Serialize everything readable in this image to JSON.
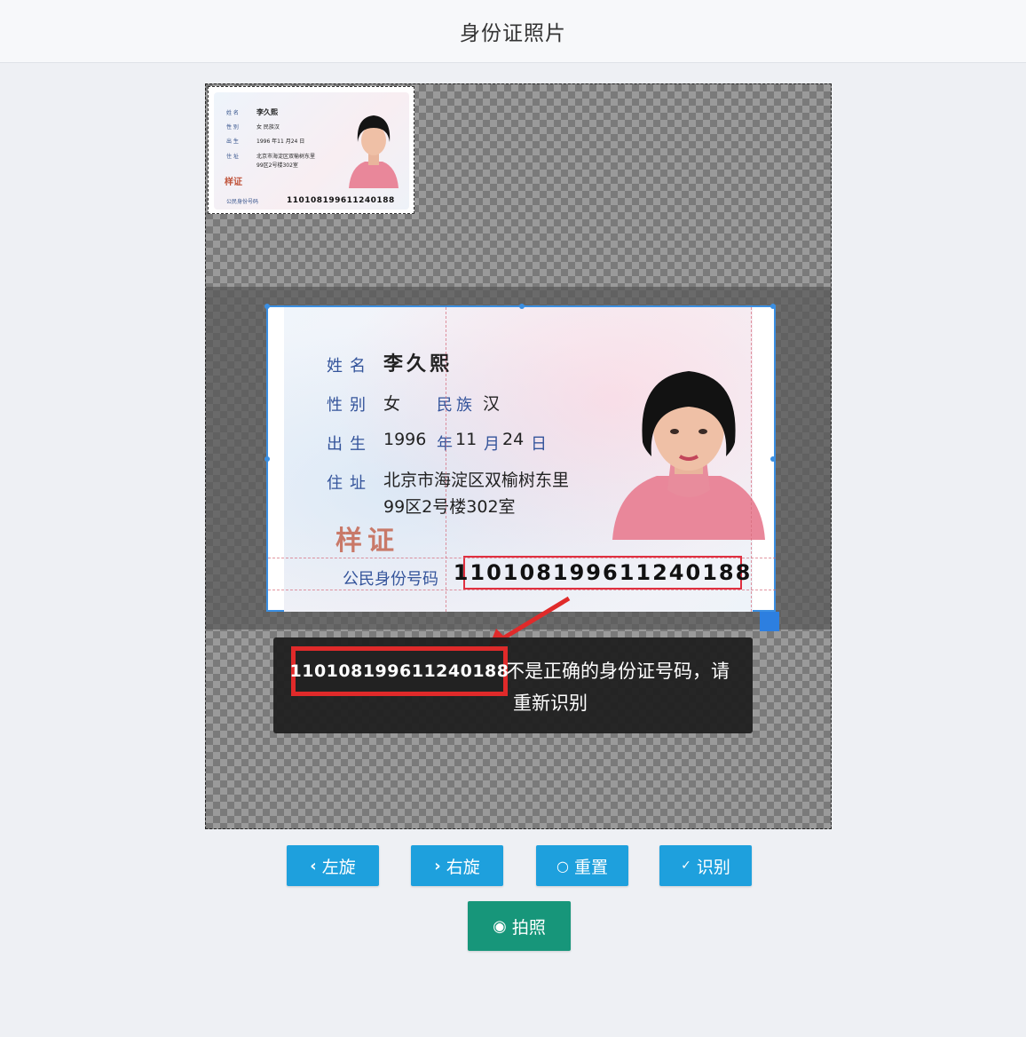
{
  "header": {
    "title": "身份证照片"
  },
  "thumbnail": {
    "labels": [
      "姓 名",
      "性 别",
      "出 生",
      "住 址",
      "公民身份号码"
    ],
    "values": [
      "李久熙",
      "女   民族汉",
      "1996 年11 月24 日",
      "北京市海淀区双榆树东里",
      "99区2号楼302室"
    ],
    "stamp": "样证",
    "id_number": "110108199611240188"
  },
  "card": {
    "name_label": "姓名",
    "name": "李久熙",
    "sex_label": "性别",
    "sex": "女",
    "ethnicity_label": "民族",
    "ethnicity": "汉",
    "birth_label": "出生",
    "birth_year": "1996",
    "birth_year_unit": "年",
    "birth_month": "11",
    "birth_month_unit": "月",
    "birth_day": "24",
    "birth_day_unit": "日",
    "address_label": "住址",
    "address_line1": "北京市海淀区双榆树东里",
    "address_line2": "99区2号楼302室",
    "stamp": "样证",
    "id_label": "公民身份号码",
    "id_number": "110108199611240188"
  },
  "toast": {
    "id_number": "110108199611240188",
    "message_line1": "不是正确的身份证号码，请",
    "message_line2": "重新识别"
  },
  "buttons": {
    "rotate_left": {
      "icon": "chevron-left-icon",
      "label": "左旋"
    },
    "rotate_right": {
      "icon": "chevron-right-icon",
      "label": "右旋"
    },
    "reset": {
      "icon": "refresh-icon",
      "label": "重置"
    },
    "recognize": {
      "icon": "check-icon",
      "label": "识别"
    },
    "capture": {
      "icon": "camera-icon",
      "label": "拍照"
    }
  },
  "colors": {
    "primary": "#1ea0dd",
    "capture": "#17967a",
    "crop_border": "#3b8fe2",
    "highlight_red": "#e02a2a"
  }
}
